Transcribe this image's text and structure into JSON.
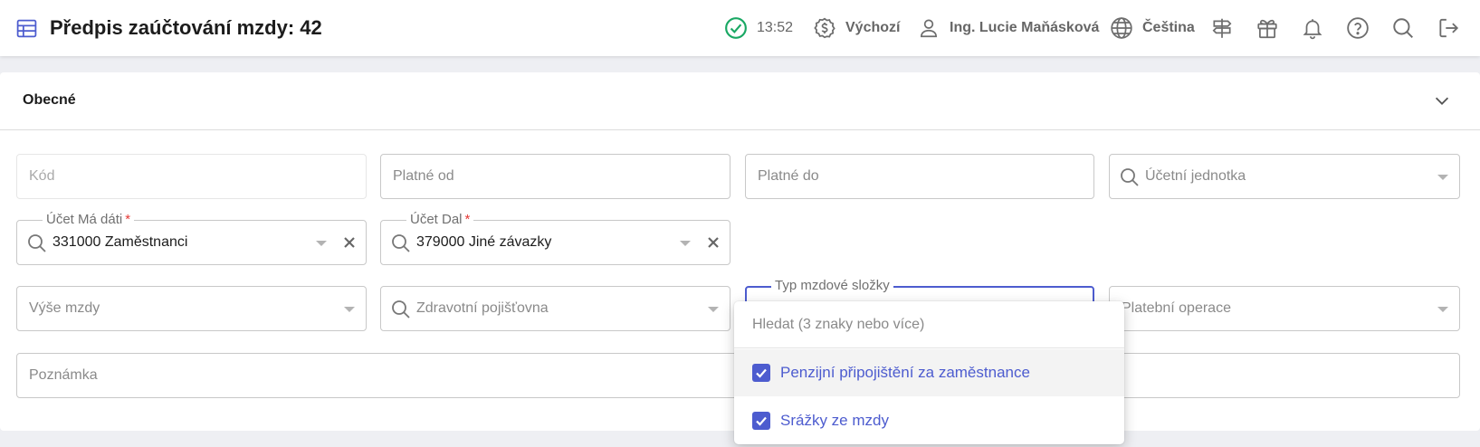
{
  "header": {
    "title": "Předpis zaúčtování mzdy: 42",
    "time": "13:52",
    "currency_profile": "Výchozí",
    "user": "Ing. Lucie Maňásková",
    "language": "Čeština",
    "accent": "#4d5ccf",
    "status_color": "#1aa864",
    "icons": [
      "table-icon",
      "check-circle-icon",
      "currency-gear-icon",
      "user-icon",
      "globe-icon",
      "signpost-icon",
      "gift-icon",
      "bell-icon",
      "help-icon",
      "search-icon",
      "logout-icon"
    ]
  },
  "section": {
    "title": "Obecné"
  },
  "form": {
    "kod": {
      "placeholder": "Kód"
    },
    "platne_od": {
      "placeholder": "Platné od"
    },
    "platne_do": {
      "placeholder": "Platné do"
    },
    "ucetni_jednotka": {
      "placeholder": "Účetní jednotka"
    },
    "ucet_ma_dati": {
      "label": "Účet Má dáti",
      "required": "*",
      "value": "331000 Zaměstnanci"
    },
    "ucet_dal": {
      "label": "Účet Dal",
      "required": "*",
      "value": "379000 Jiné závazky"
    },
    "vyse_mzdy": {
      "placeholder": "Výše mzdy"
    },
    "zdravotni_pojistovna": {
      "placeholder": "Zdravotní pojišťovna"
    },
    "typ_mzdove_slozky": {
      "label": "Typ mzdové složky"
    },
    "platebni_operace": {
      "placeholder": "Platební operace"
    },
    "poznamka": {
      "placeholder": "Poznámka"
    }
  },
  "dropdown": {
    "search_placeholder": "Hledat (3 znaky nebo více)",
    "options": [
      {
        "label": "Penzijní připojištění za zaměstnance",
        "checked": true
      },
      {
        "label": "Srážky ze mzdy",
        "checked": true
      }
    ]
  }
}
